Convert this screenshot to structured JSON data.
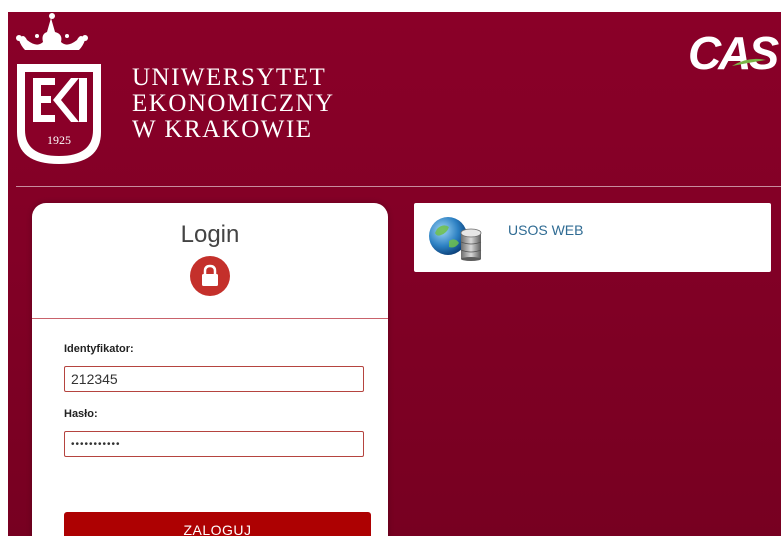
{
  "branding": {
    "name_line1": "UNIWERSYTET",
    "name_line2": "EKONOMICZNY",
    "name_line3": "W KRAKOWIE",
    "founded_year": "1925",
    "cas_logo": "CAS"
  },
  "login": {
    "title": "Login",
    "lock_icon": "lock-icon",
    "username_label": "Identyfikator:",
    "username_value": "212345",
    "password_label": "Hasło:",
    "password_value": "•••••••••••",
    "submit_label": "ZALOGUJ"
  },
  "services": {
    "items": [
      {
        "label": "USOS WEB",
        "icon": "globe-database-icon"
      }
    ]
  },
  "colors": {
    "background": "#8a0028",
    "accent": "#ad0102",
    "lock_circle": "#c4302b",
    "link": "#2f6b93"
  }
}
